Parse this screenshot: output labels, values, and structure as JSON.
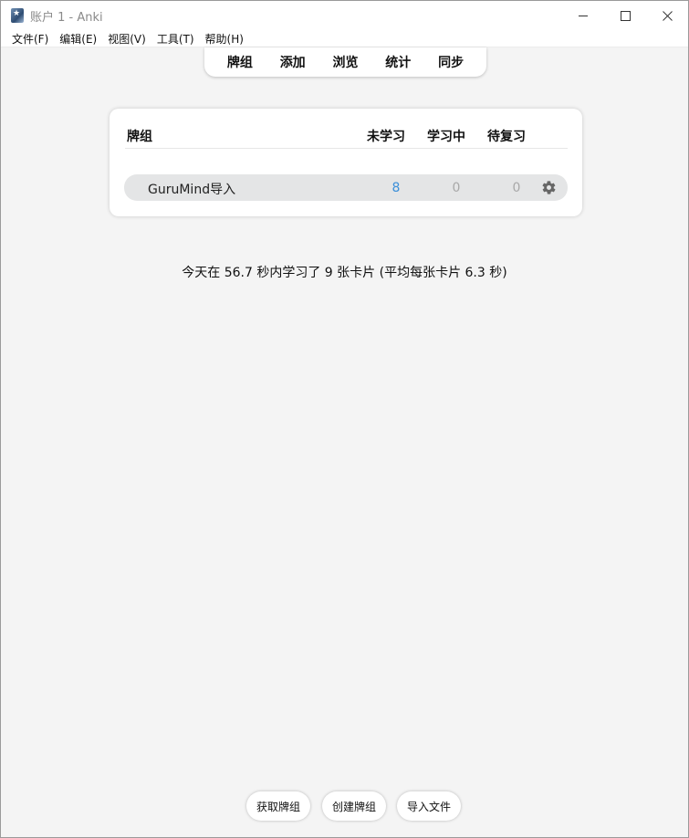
{
  "window": {
    "title": "账户 1 - Anki",
    "controls": {
      "minimize": "minimize",
      "maximize": "maximize",
      "close": "close"
    }
  },
  "menu": {
    "items": [
      {
        "label": "文件(F)"
      },
      {
        "label": "编辑(E)"
      },
      {
        "label": "视图(V)"
      },
      {
        "label": "工具(T)"
      },
      {
        "label": "帮助(H)"
      }
    ]
  },
  "toolbar": {
    "items": [
      {
        "label": "牌组"
      },
      {
        "label": "添加"
      },
      {
        "label": "浏览"
      },
      {
        "label": "统计"
      },
      {
        "label": "同步"
      }
    ]
  },
  "deck_table": {
    "headers": {
      "deck": "牌组",
      "new": "未学习",
      "learning": "学习中",
      "review": "待复习"
    },
    "rows": [
      {
        "name": "GuruMind导入",
        "new": "8",
        "learning": "0",
        "review": "0"
      }
    ]
  },
  "stats": {
    "text": "今天在 56.7 秒内学习了 9 张卡片  (平均每张卡片 6.3 秒)"
  },
  "bottom_buttons": {
    "get_shared": "获取牌组",
    "create_deck": "创建牌组",
    "import_file": "导入文件"
  },
  "colors": {
    "new_count": "#3b8fd9",
    "muted_count": "#a8a8a8",
    "row_bg": "#e4e5e6",
    "window_bg": "#f4f4f4"
  }
}
